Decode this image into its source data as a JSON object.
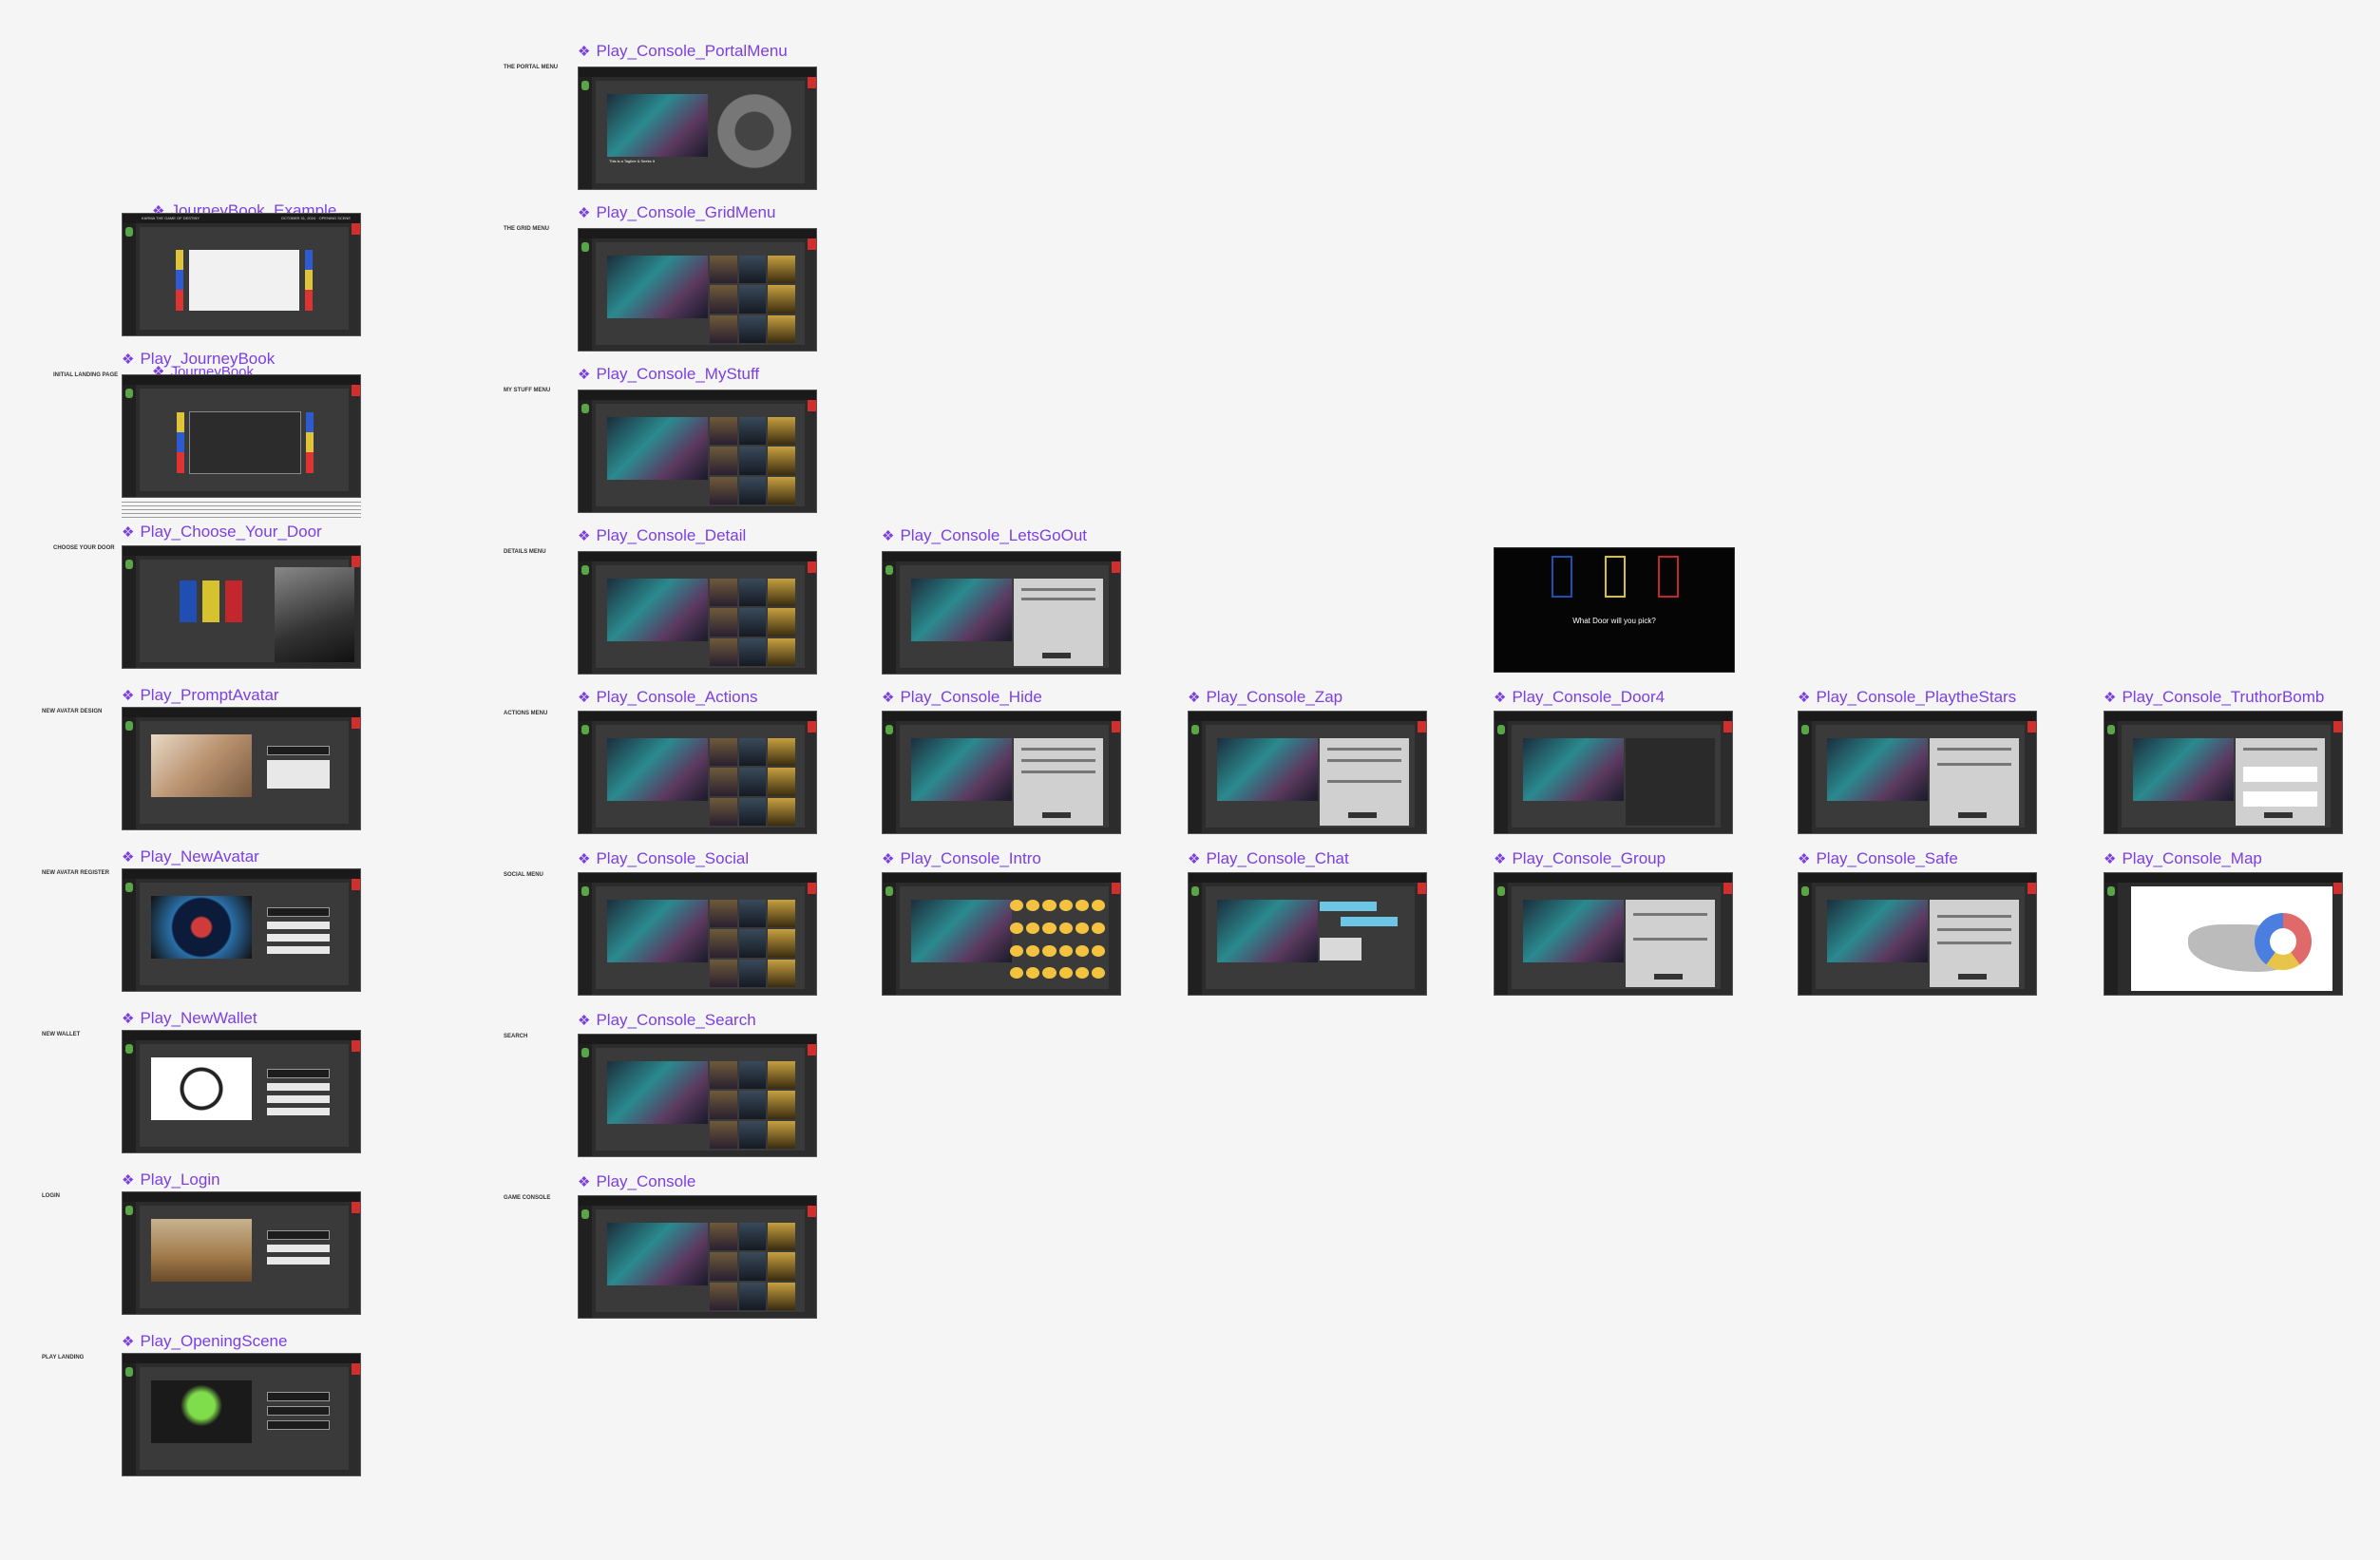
{
  "canvas": {
    "background": "#f5f5f5",
    "accent": "#7b3fe4"
  },
  "frames": [
    {
      "title": "Play_Console_PortalMenu",
      "section": "THE PORTAL MENU",
      "content": "wheel",
      "header_left": "KARMA THE GAME OF DESTINY",
      "header_right": "OCTOBER 31, 2024 · OPENING SCENE",
      "caption": "This is a Tagline & Seeks It"
    },
    {
      "title": "JourneyBook_Example",
      "section": "",
      "content": "journal"
    },
    {
      "title": "Play_Console_GridMenu",
      "section": "THE GRID MENU",
      "content": "grid"
    },
    {
      "title": "Play_JourneyBook",
      "section": "INITIAL LANDING PAGE",
      "content": "journal"
    },
    {
      "title": "JourneyBook",
      "section": "",
      "content": ""
    },
    {
      "title": "Play_Console_MyStuff",
      "section": "MY STUFF MENU",
      "content": "grid"
    },
    {
      "title": "Play_Choose_Your_Door",
      "section": "CHOOSE YOUR DOOR",
      "content": "doors"
    },
    {
      "title": "Play_Console_Detail",
      "section": "DETAILS MENU",
      "content": "grid"
    },
    {
      "title": "Play_Console_LetsGoOut",
      "section": "",
      "content": "panel"
    },
    {
      "title": "Play_PromptAvatar",
      "section": "NEW AVATAR DESIGN",
      "content": "form"
    },
    {
      "title": "Play_Console_Actions",
      "section": "ACTIONS MENU",
      "content": "grid"
    },
    {
      "title": "Play_Console_Hide",
      "section": "",
      "content": "panel"
    },
    {
      "title": "Play_Console_Zap",
      "section": "",
      "content": "panel"
    },
    {
      "title": "Play_Console_Door4",
      "section": "",
      "content": "panel-dark"
    },
    {
      "title": "Play_Console_PlaytheStars",
      "section": "",
      "content": "panel"
    },
    {
      "title": "Play_Console_TruthorBomb",
      "section": "",
      "content": "panel"
    },
    {
      "title": "Play_NewAvatar",
      "section": "NEW AVATAR REGISTER",
      "content": "form"
    },
    {
      "title": "Play_Console_Social",
      "section": "SOCIAL MENU",
      "content": "grid"
    },
    {
      "title": "Play_Console_Intro",
      "section": "",
      "content": "emoji"
    },
    {
      "title": "Play_Console_Chat",
      "section": "",
      "content": "chat"
    },
    {
      "title": "Play_Console_Group",
      "section": "",
      "content": "panel"
    },
    {
      "title": "Play_Console_Safe",
      "section": "",
      "content": "panel"
    },
    {
      "title": "Play_Console_Map",
      "section": "",
      "content": "map"
    },
    {
      "title": "Play_NewWallet",
      "section": "NEW WALLET",
      "content": "form"
    },
    {
      "title": "Play_Console_Search",
      "section": "SEARCH",
      "content": "grid"
    },
    {
      "title": "Play_Login",
      "section": "LOGIN",
      "content": "form"
    },
    {
      "title": "Play_Console",
      "section": "GAME CONSOLE",
      "content": "grid"
    },
    {
      "title": "Play_OpeningScene",
      "section": "PLAY LANDING",
      "content": "form"
    }
  ],
  "door_card": {
    "prompt": "What Door will you pick?"
  },
  "door_colors": [
    "#1f4fb3",
    "#d6c12f",
    "#c2272d"
  ]
}
